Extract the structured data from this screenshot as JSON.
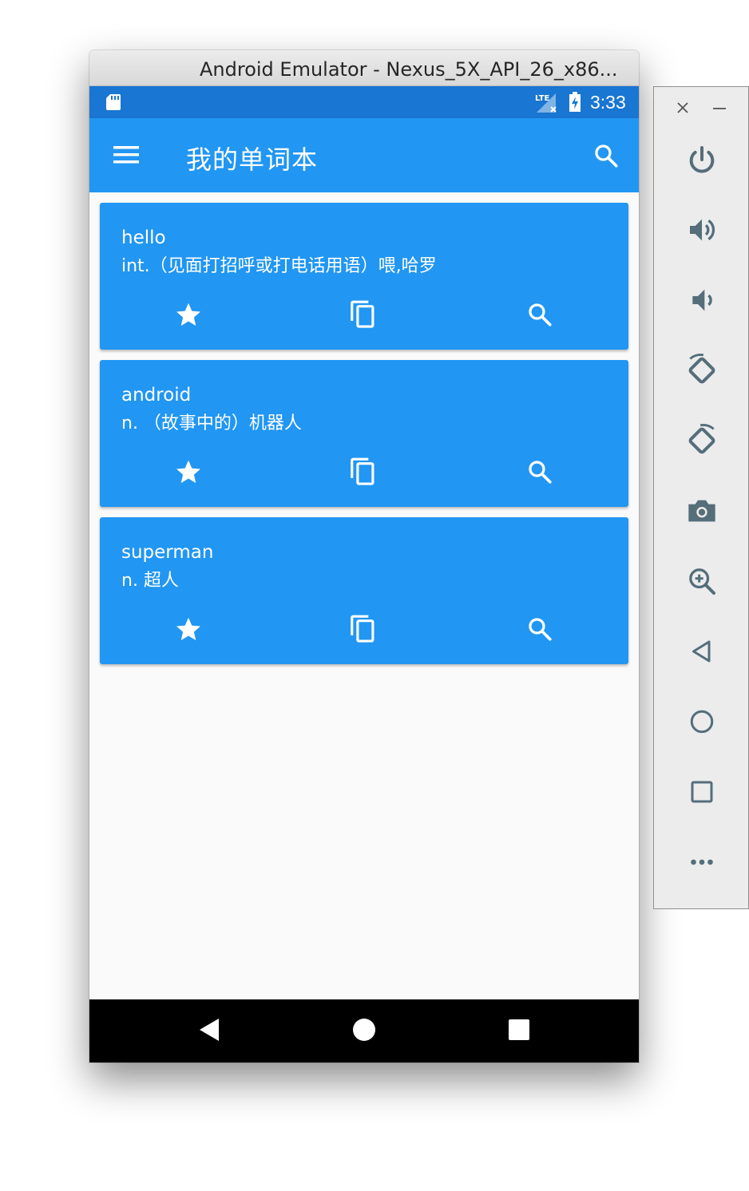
{
  "window": {
    "title": "Android Emulator - Nexus_5X_API_26_x86..."
  },
  "status_bar": {
    "time": "3:33",
    "network": "LTE"
  },
  "app_bar": {
    "title": "我的单词本"
  },
  "words": [
    {
      "word": "hello",
      "definition": "int.（见面打招呼或打电话用语）喂,哈罗"
    },
    {
      "word": "android",
      "definition": "n. （故事中的）机器人"
    },
    {
      "word": "superman",
      "definition": "n. 超人"
    }
  ],
  "card_actions": [
    "star-icon",
    "copy-icon",
    "search-icon"
  ],
  "side_panel": {
    "buttons": [
      "power-icon",
      "volume-up-icon",
      "volume-down-icon",
      "rotate-left-icon",
      "rotate-right-icon",
      "camera-icon",
      "zoom-icon",
      "back-icon",
      "home-icon",
      "overview-icon",
      "more-icon"
    ]
  },
  "colors": {
    "primary": "#2196f3",
    "primary_dark": "#1976d2",
    "background": "#fafafa",
    "panel_icon": "#546e7a"
  }
}
